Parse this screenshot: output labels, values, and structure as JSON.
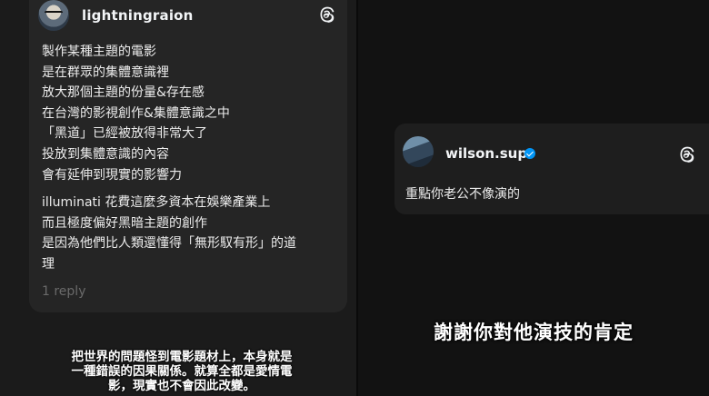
{
  "left_post": {
    "username": "lightningraion",
    "icons": {
      "avatar": "avatar",
      "app": "threads-icon"
    },
    "paragraphs": [
      {
        "lines": [
          "製作某種主題的電影",
          "是在群眾的集體意識裡",
          "放大那個主題的份量&存在感",
          "在台灣的影視創作&集體意識之中",
          "「黑道」已經被放得非常大了",
          "投放到集體意識的內容",
          "會有延伸到現實的影響力"
        ]
      },
      {
        "lines": [
          "illuminati 花費這麼多資本在娛樂產業上",
          "而且極度偏好黑暗主題的創作",
          "是因為他們比人類還懂得「無形馭有形」的道",
          "理"
        ]
      }
    ],
    "reply_count": "1 reply"
  },
  "left_subtitle": {
    "lines": [
      "把世界的問題怪到電影題材上，本身就是",
      "一種錯誤的因果關係。就算全都是愛情電",
      "影，現實也不會因此改變。"
    ]
  },
  "right_post": {
    "username": "wilson.sup",
    "verified": true,
    "icons": {
      "avatar": "avatar",
      "badge": "verified-badge-icon",
      "app": "threads-icon"
    },
    "text": "重點你老公不像演的"
  },
  "right_caption": "謝謝你對他演技的肯定",
  "colors": {
    "background": "#101010",
    "card": "#252525",
    "text": "#f3f5f7",
    "muted": "#6a6a6a",
    "verified": "#0095f6"
  }
}
